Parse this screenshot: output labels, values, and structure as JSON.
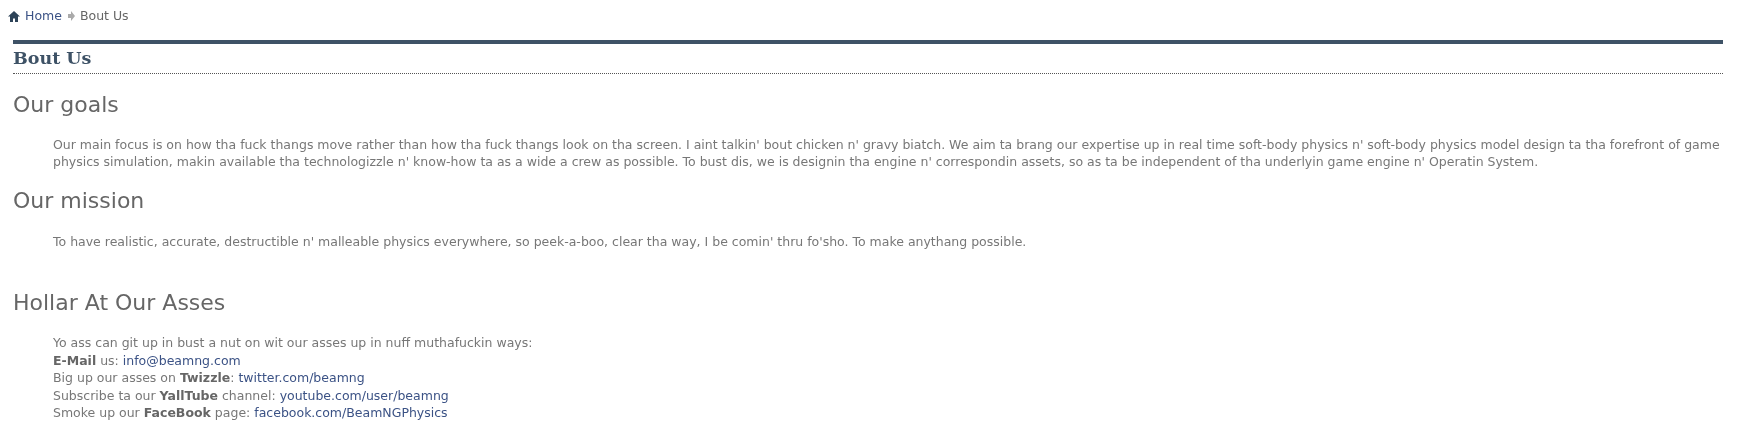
{
  "breadcrumb": [
    {
      "label": "Home",
      "link": true
    },
    {
      "label": "Bout Us",
      "link": false
    }
  ],
  "page_title": "Bout Us",
  "sections": [
    {
      "heading": "Our goals",
      "paragraphs": [
        "Our main focus is on how tha fuck thangs move rather than how tha fuck thangs look on tha screen. I aint talkin' bout chicken n' gravy biatch. We aim ta brang our expertise up in real time soft-body physics n' soft-body physics model design ta tha forefront of game physics simulation, makin available tha technologizzle n' know-how ta as a wide a crew as possible. To bust dis, we is designin tha engine n' correspondin assets, so as ta be independent of tha underlyin game engine n' Operatin System."
      ]
    },
    {
      "heading": "Our mission",
      "paragraphs": [
        "To have realistic, accurate, destructible n' malleable physics everywhere, so peek-a-boo, clear tha way, I be comin' thru fo'sho. To make anythang possible."
      ]
    }
  ],
  "contact": {
    "heading": "Hollar At Our Asses",
    "lines": [
      {
        "text": "Yo ass can git up in bust a nut on wit our asses up in nuff muthafuckin ways:"
      },
      {
        "text": "**E-Mail** us:",
        "link": "info@beamng.com"
      },
      {
        "text": "Big up our asses on **Twizzle**:",
        "link": "twitter.com/beamng"
      },
      {
        "text": "Subscribe ta our **YallTube** channel:",
        "link": "youtube.com/user/beamng"
      },
      {
        "text": "Smoke up our **FaceBook** page:",
        "link": "facebook.com/BeamNGPhysics"
      }
    ]
  }
}
